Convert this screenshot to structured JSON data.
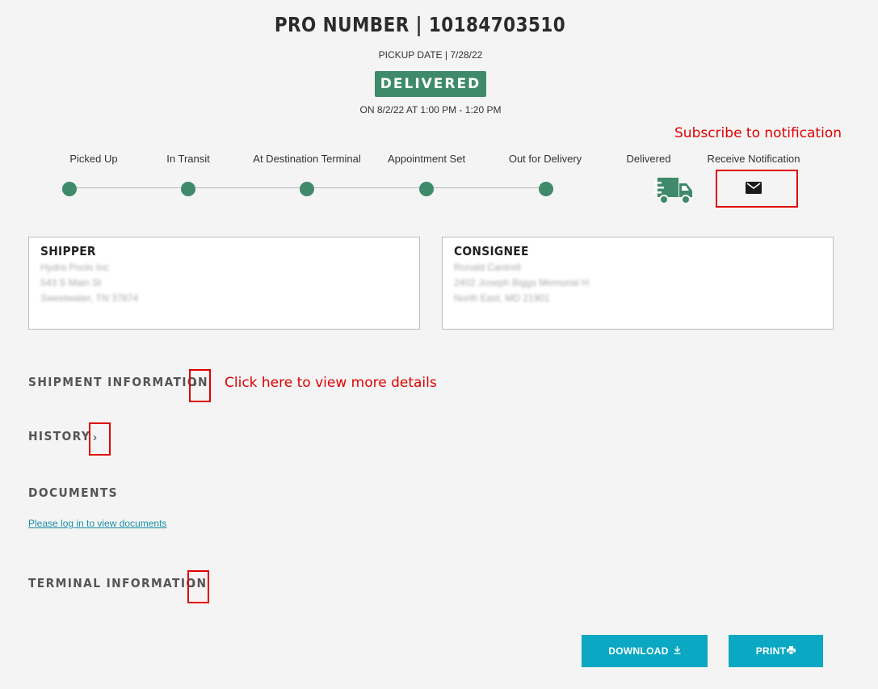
{
  "header": {
    "pro_number": "PRO NUMBER | 10184703510",
    "pickup_date": "PICKUP DATE | 7/28/22",
    "status": "DELIVERED",
    "delivered_on": "ON 8/2/22 AT 1:00 PM - 1:20 PM",
    "status_color": "#3e8a6b"
  },
  "annotations": {
    "subscribe": "Subscribe to notification",
    "details": "Click here to view more details",
    "color": "#e00000"
  },
  "tracker": {
    "steps": [
      "Picked Up",
      "In Transit",
      "At Destination Terminal",
      "Appointment Set",
      "Out for Delivery",
      "Delivered",
      "Receive Notification"
    ],
    "current_icon": "truck-icon",
    "notify_icon": "envelope-icon"
  },
  "shipper": {
    "title": "SHIPPER",
    "lines": [
      "Hydra Pools Inc",
      "543 S Main St",
      "Sweetwater, TN 37874"
    ]
  },
  "consignee": {
    "title": "CONSIGNEE",
    "lines": [
      "Ronald Cantrell",
      "2402 Joseph Biggs Memorial H",
      "North East, MD 21901"
    ]
  },
  "sections": {
    "shipment_info": "SHIPMENT INFORMATION",
    "history": "HISTORY",
    "documents": "DOCUMENTS",
    "documents_link": "Please log in to view documents",
    "terminal_info": "TERMINAL INFORMATION"
  },
  "actions": {
    "download": "DOWNLOAD",
    "print": "PRINT",
    "button_color": "#0aa8c2"
  }
}
